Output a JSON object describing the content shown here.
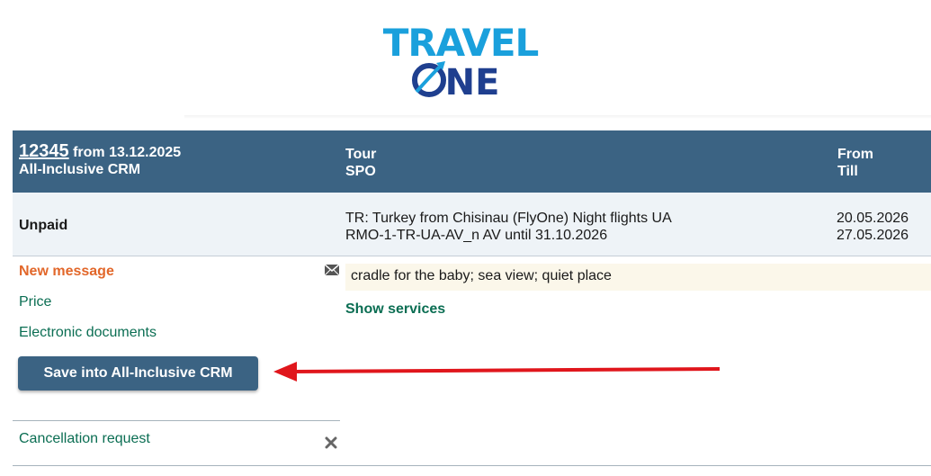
{
  "logo": {
    "line1": "TRAVEL",
    "line2": "ONE"
  },
  "header": {
    "order_number": "12345",
    "order_from": "from 13.12.2025",
    "crm_label": "All-Inclusive CRM",
    "col_tour": "Tour",
    "col_spo": "SPO",
    "col_from": "From",
    "col_till": "Till"
  },
  "status": {
    "label": "Unpaid",
    "tour_line": "TR: Turkey from Chisinau (FlyOne) Night flights UA",
    "spo_line": "RMO-1-TR-UA-AV_n AV until 31.10.2026",
    "date_from": "20.05.2026",
    "date_till": "27.05.2026"
  },
  "actions": {
    "new_message": "New message",
    "price": "Price",
    "electronic_documents": "Electronic documents",
    "save_button": "Save into All-Inclusive CRM",
    "cancellation_request": "Cancellation request"
  },
  "notes": "cradle for the baby; sea view; quiet place",
  "show_services": "Show services",
  "icons": {
    "envelope": "envelope-icon",
    "close": "close-icon",
    "arrow": "arrow-annotation"
  },
  "colors": {
    "header_bg": "#3b6383",
    "logo_blue_light": "#1aa0dc",
    "logo_blue_dark": "#1f3f8f",
    "link_green": "#0b6e53",
    "new_message_orange": "#e2672a",
    "arrow_red": "#e0161c",
    "notes_bg": "#fbf7ea"
  }
}
